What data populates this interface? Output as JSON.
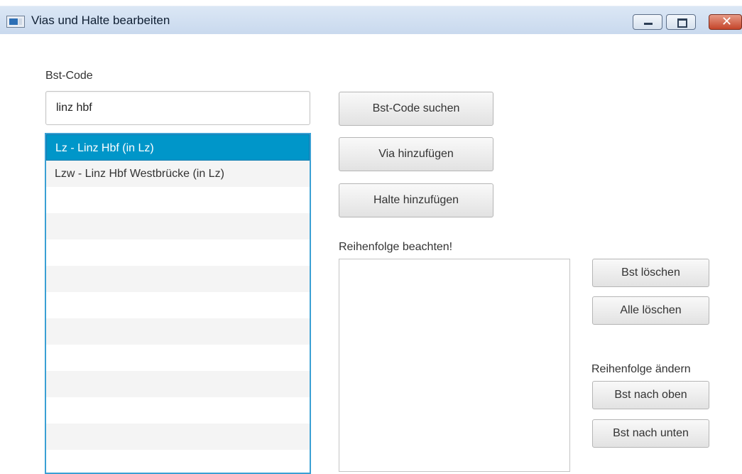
{
  "window": {
    "title": "Vias und Halte bearbeiten",
    "close_glyph": "✕"
  },
  "search": {
    "label": "Bst-Code",
    "value": "linz hbf"
  },
  "results": [
    {
      "text": "Lz -  Linz Hbf (in Lz)",
      "selected": true
    },
    {
      "text": "Lzw -  Linz Hbf Westbrücke (in Lz)",
      "selected": false
    }
  ],
  "buttons": {
    "search": "Bst-Code suchen",
    "add_via": "Via hinzufügen",
    "add_stop": "Halte hinzufügen",
    "delete_stop": "Bst löschen",
    "delete_all": "Alle löschen",
    "move_up": "Bst nach oben",
    "move_down": "Bst nach unten"
  },
  "order": {
    "label": "Reihenfolge beachten!",
    "change_label": "Reihenfolge ändern",
    "items": []
  },
  "colors": {
    "selection": "#0096c9",
    "list_border": "#3aa0d4"
  }
}
